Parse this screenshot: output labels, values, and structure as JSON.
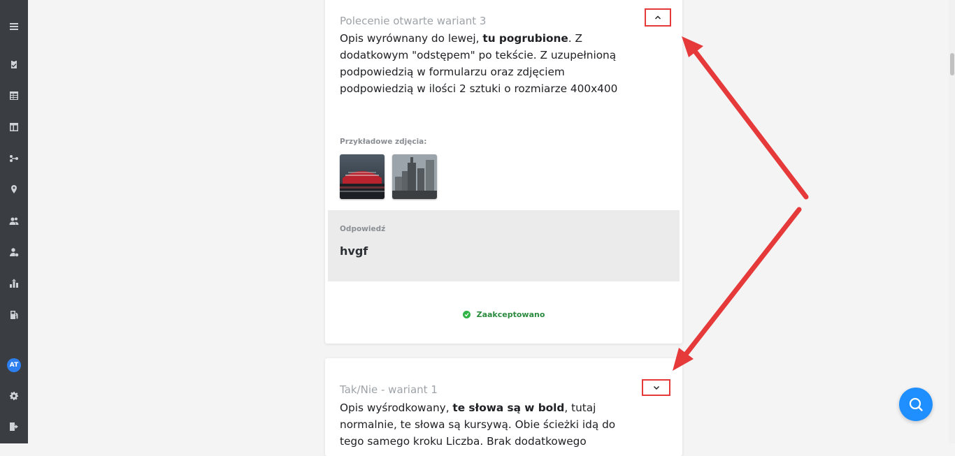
{
  "sidebar": {
    "icons": [
      "menu-icon",
      "clipboard-check-icon",
      "table-icon",
      "layout-icon",
      "workflow-icon",
      "location-pin-icon",
      "users-icon",
      "user-settings-icon",
      "chart-icon",
      "fuel-icon"
    ],
    "avatar_initials": "AT",
    "bottom_icons": [
      "gear-icon",
      "logout-icon"
    ]
  },
  "card1": {
    "title": "Polecenie otwarte wariant 3",
    "desc_pre": "Opis wyrównany do lewej, ",
    "desc_bold": "tu pogrubione",
    "desc_post": ". Z dodatkowym \"odstępem\" po tekście. Z uzupełnioną podpowiedzią w formularzu oraz zdjęciem podpowiedzią w ilości 2 sztuki o rozmiarze 400x400",
    "photos_label": "Przykładowe zdjęcia:",
    "answer_label": "Odpowiedź",
    "answer_value": "hvgf",
    "status": "Zaakceptowano",
    "toggle_icon": "chevron-up-icon"
  },
  "card2": {
    "title": "Tak/Nie - wariant 1",
    "desc_pre": "Opis wyśrodkowany, ",
    "desc_bold": "te słowa są w bold",
    "desc_post": ", tutaj normalnie, te słowa są kursywą. Obie ścieżki idą do tego samego kroku Liczba. Brak dodatkowego",
    "toggle_icon": "chevron-down-icon"
  },
  "colors": {
    "sidebar": "#3a3d42",
    "accent": "#1f8fff",
    "annotation": "#e5393a",
    "success": "#2fb344"
  }
}
